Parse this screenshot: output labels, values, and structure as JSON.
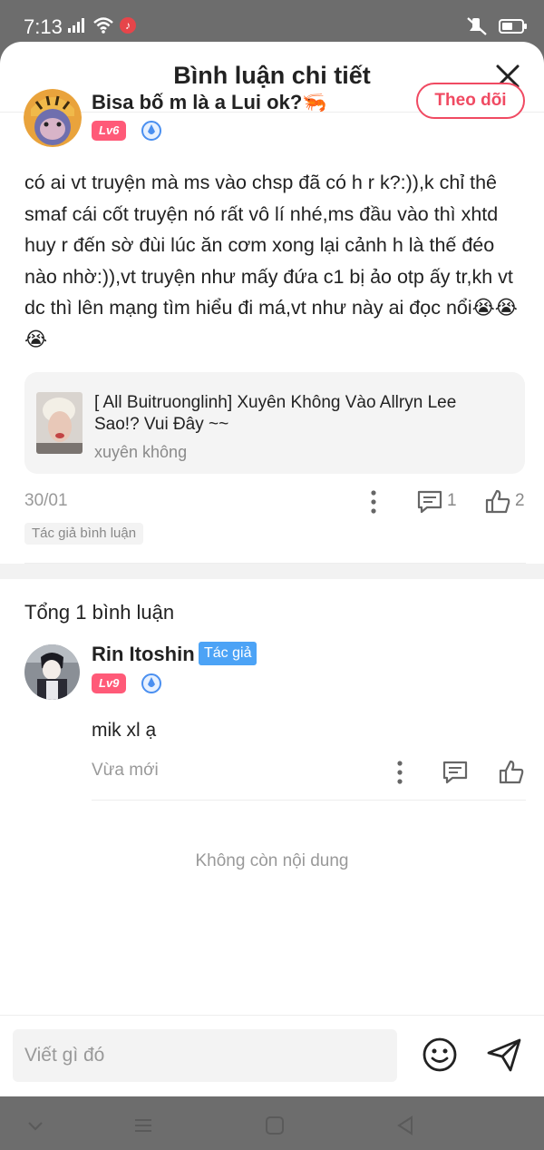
{
  "status_bar": {
    "time": "7:13",
    "icons": [
      "signal-icon",
      "wifi-icon",
      "music-app-icon",
      "mute-icon",
      "battery-icon"
    ]
  },
  "header": {
    "title": "Bình luận chi tiết",
    "close_icon": "close-icon"
  },
  "post": {
    "username": "Bisa bố m là a Lui ok?🦐",
    "level": "Lv6",
    "follow_label": "Theo dõi",
    "text": "có ai vt truyện mà ms vào chsp đã có h r k?:)),k chỉ thê smaf cái cốt truyện nó rất vô lí nhé,ms đầu vào thì xhtd huy r đến sờ đùi lúc ăn cơm xong lại cảnh h là thế đéo nào nhờ:)),vt truyện như mấy đứa c1 bị ảo otp ấy tr,kh vt dc thì lên mạng tìm hiểu đi má,vt như này ai đọc nổi😭😭😭",
    "story_card": {
      "title": "[ All Buitruonglinh] Xuyên Không Vào Allryn Lee Sao!? Vui Đây ~~",
      "genre": "xuyên không"
    },
    "date": "30/01",
    "comment_count": "1",
    "like_count": "2",
    "author_tag": "Tác giả bình luận"
  },
  "comments": {
    "total_label": "Tổng 1 bình luận",
    "reply": {
      "name": "Rin Itoshin",
      "author_badge": "Tác giả",
      "level": "Lv9",
      "text": "mik xl ạ",
      "time": "Vừa mới"
    },
    "end_label": "Không còn nội dung"
  },
  "input": {
    "placeholder": "Viết gì đó"
  },
  "colors": {
    "accent": "#f04a62",
    "level_badge": "#ff5a78",
    "author_badge": "#4ca3f6"
  }
}
